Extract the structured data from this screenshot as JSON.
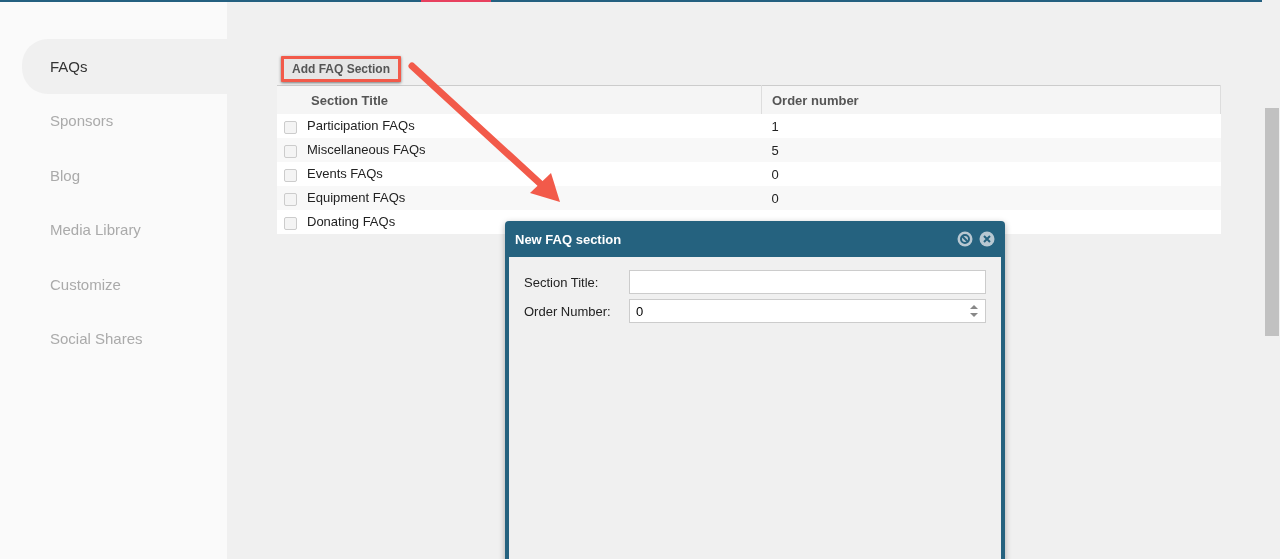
{
  "sidebar": {
    "items": [
      {
        "label": "FAQs",
        "selected": true
      },
      {
        "label": "Sponsors",
        "selected": false
      },
      {
        "label": "Blog",
        "selected": false
      },
      {
        "label": "Media Library",
        "selected": false
      },
      {
        "label": "Customize",
        "selected": false
      },
      {
        "label": "Social Shares",
        "selected": false
      }
    ]
  },
  "toolbar": {
    "add_button": "Add FAQ Section"
  },
  "table": {
    "columns": [
      "Section Title",
      "Order number"
    ],
    "rows": [
      {
        "title": "Participation FAQs",
        "order": "1",
        "checked": false
      },
      {
        "title": "Miscellaneous FAQs",
        "order": "5",
        "checked": false
      },
      {
        "title": "Events FAQs",
        "order": "0",
        "checked": false
      },
      {
        "title": "Equipment FAQs",
        "order": "0",
        "checked": false
      },
      {
        "title": "Donating FAQs",
        "checked": false
      }
    ]
  },
  "dialog": {
    "title": "New FAQ section",
    "fields": [
      {
        "label": "Section Title:",
        "kind": "text"
      },
      {
        "label": "Order Number:",
        "kind": "number",
        "value": "0"
      }
    ]
  }
}
